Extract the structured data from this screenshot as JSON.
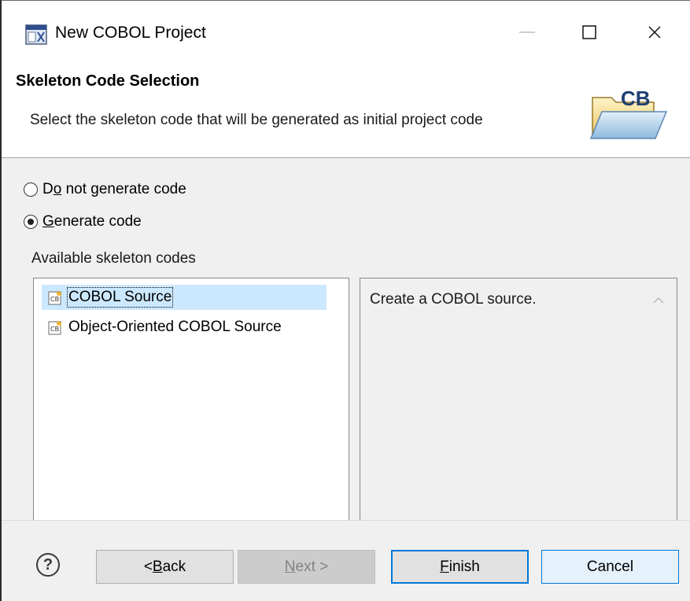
{
  "window": {
    "title": "New COBOL Project",
    "close_glyph": "×"
  },
  "header": {
    "title": "Skeleton Code Selection",
    "description": "Select the skeleton code that will be generated as initial project code",
    "graphic_text": "CB"
  },
  "options": {
    "no_generate": {
      "pre": "D",
      "mnemonic": "o",
      "post": " not generate code",
      "selected": false
    },
    "generate": {
      "pre": "",
      "mnemonic": "G",
      "post": "enerate code",
      "selected": true
    }
  },
  "skeletons": {
    "label": "Available skeleton codes",
    "items": [
      {
        "label": "COBOL Source",
        "selected": true
      },
      {
        "label": "Object-Oriented COBOL Source",
        "selected": false
      }
    ],
    "description": "Create a COBOL source."
  },
  "buttons": {
    "help": "?",
    "back_pre": "< ",
    "back_mnemonic": "B",
    "back_post": "ack",
    "next_mnemonic": "N",
    "next_post": "ext >",
    "finish_mnemonic": "F",
    "finish_post": "inish",
    "cancel": "Cancel"
  },
  "colors": {
    "accent": "#0078d7",
    "selection": "#cce8ff",
    "dialog_bg": "#f0f0f0"
  }
}
